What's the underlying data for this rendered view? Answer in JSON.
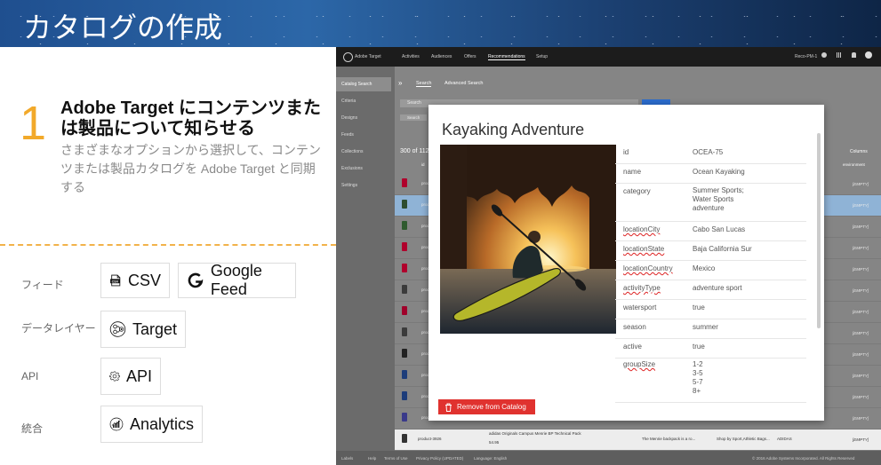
{
  "banner": {
    "title": "カタログの作成"
  },
  "step": {
    "number": "1",
    "heading": "Adobe Target にコンテンツまたは製品について知らせる",
    "subtext": "さまざまなオプションから選択して、コンテンツまたは製品カタログを Adobe Target と同期する"
  },
  "categories": [
    {
      "label": "フィード",
      "chips": [
        {
          "icon": "csv-icon",
          "text": "CSV"
        },
        {
          "icon": "google-g-icon",
          "text": "Google Feed"
        }
      ]
    },
    {
      "label": "データレイヤー",
      "chips": [
        {
          "icon": "target-icon",
          "text": "Target"
        }
      ]
    },
    {
      "label": "API",
      "chips": [
        {
          "icon": "gear-icon",
          "text": "API"
        }
      ]
    },
    {
      "label": "統合",
      "chips": [
        {
          "icon": "analytics-icon",
          "text": "Analytics"
        }
      ]
    }
  ],
  "app": {
    "brand": "Adobe Target",
    "nav": [
      "Activities",
      "Audiences",
      "Offers",
      "Recommendations",
      "Setup"
    ],
    "account": "Reco-PM-1",
    "sidebar": [
      "Catalog Search",
      "Criteria",
      "Designs",
      "Feeds",
      "Collections",
      "Exclusions",
      "Settings"
    ],
    "tabs": {
      "search": "Search",
      "advanced": "Advanced Search"
    },
    "search_placeholder": "Search",
    "search_tag": "Search",
    "results_count": "300 of 112",
    "columns_label": "Columns",
    "col_id": "id",
    "col_environment": "environment",
    "empty_value": "[EMPTY]",
    "product_prefix": "prod",
    "last_row": {
      "id": "product-3926",
      "name": "adidas Originals Campus Menrie BP Technical Pack",
      "price": "54.95",
      "desc": "The Menrie backpack is a ro...",
      "category": "Shop by Sport,Athletic Bags...",
      "brand": "ADIDAS"
    },
    "footer": [
      "Labels",
      "Help",
      "Terms of Use",
      "Privacy Policy (UPDATED)",
      "Language: English",
      "© 2016 Adobe Systems Incorporated. All Rights Reserved"
    ]
  },
  "modal": {
    "title": "Kayaking Adventure",
    "attributes": [
      {
        "key": "id",
        "value": "OCEA-75",
        "spell": false
      },
      {
        "key": "name",
        "value": "Ocean Kayaking",
        "spell": false
      },
      {
        "key": "category",
        "value": "Summer Sports;\nWater Sports\nadventure",
        "spell": false
      },
      {
        "key": "locationCity",
        "value": "Cabo San Lucas",
        "spell": true
      },
      {
        "key": "locationState",
        "value": "Baja California Sur",
        "spell": true
      },
      {
        "key": "locationCountry",
        "value": "Mexico",
        "spell": true
      },
      {
        "key": "activityType",
        "value": "adventure sport",
        "spell": true
      },
      {
        "key": "watersport",
        "value": "true",
        "spell": false
      },
      {
        "key": "season",
        "value": "summer",
        "spell": false
      },
      {
        "key": "active",
        "value": "true",
        "spell": false
      },
      {
        "key": "groupSize",
        "value": "1-2\n3-5\n5-7\n8+",
        "spell": true
      }
    ],
    "remove_label": "Remove from Catalog"
  }
}
